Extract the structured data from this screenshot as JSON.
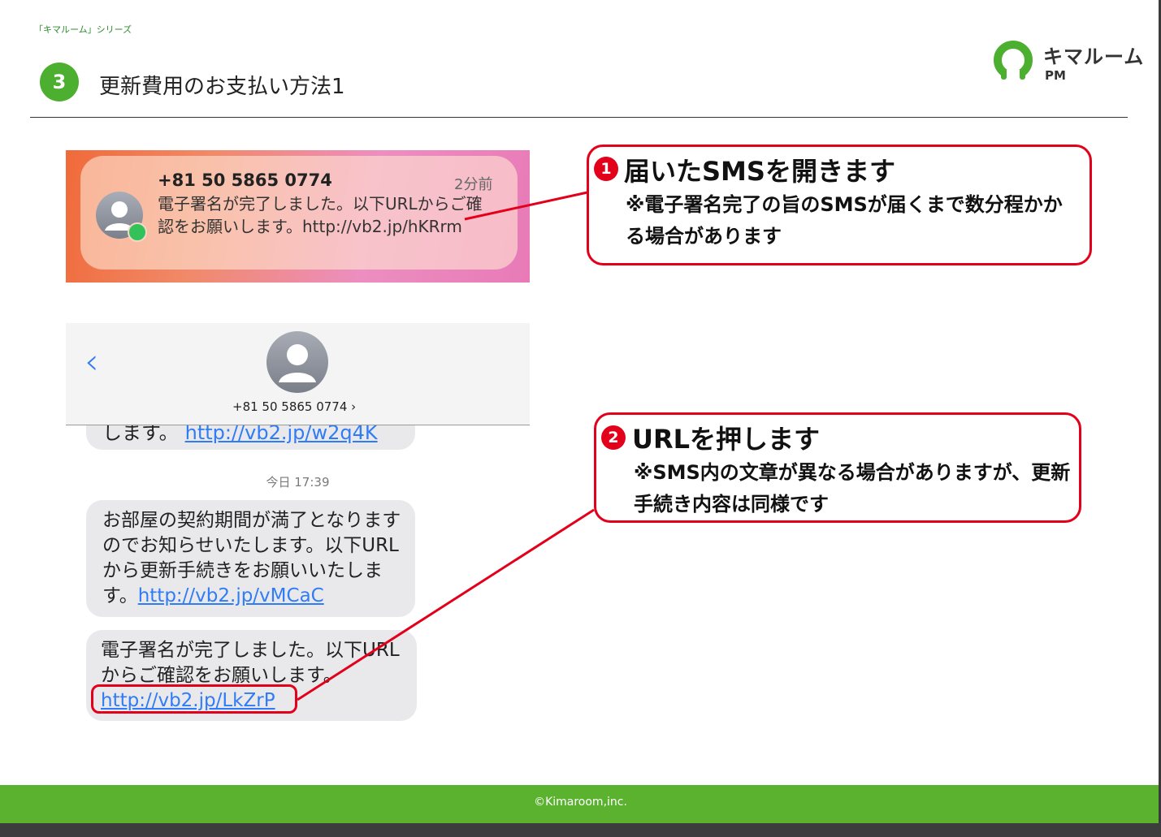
{
  "header": {
    "series_label": "「キマルーム」シリーズ",
    "step_number": "3",
    "title": "更新費用のお支払い方法1"
  },
  "logo": {
    "name": "キマルーム",
    "sub": "PM"
  },
  "notification": {
    "sender": "+81 50 5865 0774",
    "time": "2分前",
    "body": "電子署名が完了しました。以下URLからご確認をお願いします。http://vb2.jp/hKRrm"
  },
  "messages": {
    "contact_number": "+81 50 5865 0774 ›",
    "partial_prefix": "します。",
    "partial_link": "http://vb2.jp/w2q4K",
    "timestamp": "今日 17:39",
    "bubble1_text": "お部屋の契約期間が満了となりますのでお知らせいたします。以下URLから更新手続きをお願いいたします。",
    "bubble1_link": "http://vb2.jp/vMCaC",
    "bubble2_text": "電子署名が完了しました。以下URLからご確認をお願いします。",
    "bubble2_link": "http://vb2.jp/LkZrP"
  },
  "callouts": [
    {
      "number": "1",
      "title": "届いたSMSを開きます",
      "note": "※電子署名完了の旨のSMSが届くまで数分程かかる場合があります"
    },
    {
      "number": "2",
      "title": "URLを押します",
      "note": "※SMS内の文章が異なる場合がありますが、更新手続き内容は同様です"
    }
  ],
  "footer": {
    "copyright": "©Kimaroom,inc."
  },
  "colors": {
    "brand_green": "#5ab22f",
    "accent_red": "#e3001b",
    "link_blue": "#2f7cf6"
  }
}
